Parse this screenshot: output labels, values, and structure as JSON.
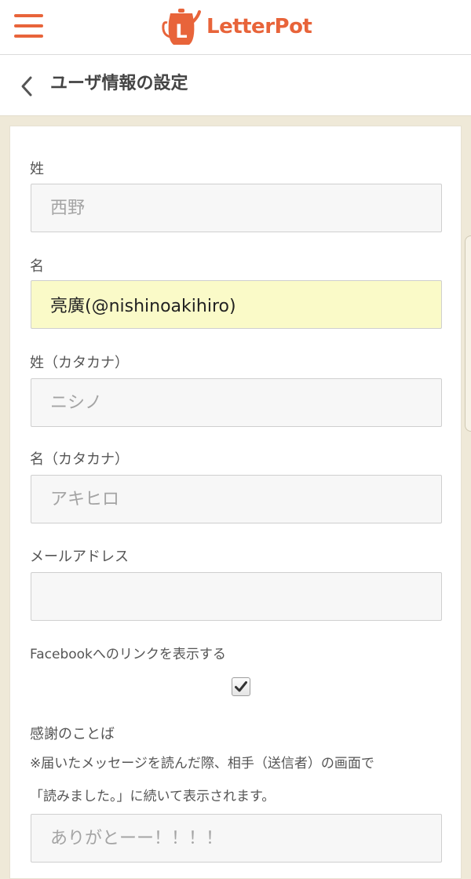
{
  "header": {
    "logo_text": "LetterPot",
    "logo_mark": "L",
    "menu_icon": "hamburger-icon"
  },
  "subheader": {
    "back_icon": "chevron-left-icon",
    "title": "ユーザ情報の設定"
  },
  "form": {
    "last_name": {
      "label": "姓",
      "value": "",
      "placeholder": "西野"
    },
    "first_name": {
      "label": "名",
      "value": "亮廣(@nishinoakihiro)",
      "placeholder": ""
    },
    "last_name_kana": {
      "label": "姓（カタカナ）",
      "value": "",
      "placeholder": "ニシノ"
    },
    "first_name_kana": {
      "label": "名（カタカナ）",
      "value": "",
      "placeholder": "アキヒロ"
    },
    "email": {
      "label": "メールアドレス",
      "value": "",
      "placeholder": ""
    },
    "facebook_link": {
      "label": "Facebookへのリンクを表示する",
      "checked": true
    },
    "thanks": {
      "label": "感謝のことば",
      "note_line1": "※届いたメッセージを読んだ際、相手（送信者）の画面で",
      "note_line2": "「読みました。」に続いて表示されます。",
      "value": "",
      "placeholder": "ありがとーー！！！！"
    }
  },
  "colors": {
    "brand": "#e8643a",
    "page_bg": "#efe9d8",
    "autofill_bg": "#fafac8"
  }
}
